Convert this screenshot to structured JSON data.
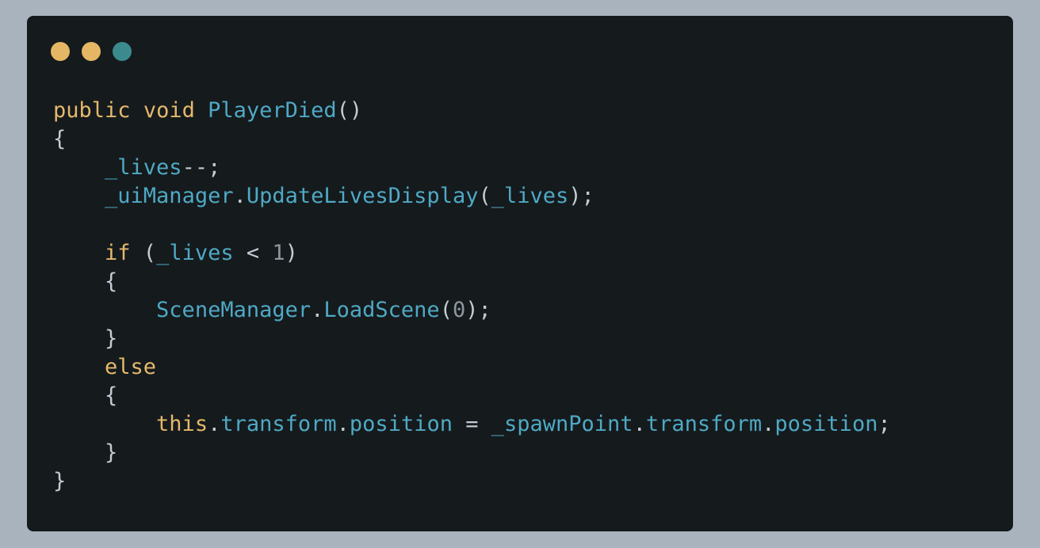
{
  "window": {
    "dots": [
      {
        "name": "dot-1",
        "color": "#e5b764"
      },
      {
        "name": "dot-2",
        "color": "#e5b764"
      },
      {
        "name": "dot-3",
        "color": "#3b8a8e"
      }
    ]
  },
  "code": {
    "lines": [
      [
        {
          "t": "public",
          "c": "kw"
        },
        {
          "t": " ",
          "c": "pn"
        },
        {
          "t": "void",
          "c": "kw"
        },
        {
          "t": " ",
          "c": "pn"
        },
        {
          "t": "PlayerDied",
          "c": "fn"
        },
        {
          "t": "()",
          "c": "pn"
        }
      ],
      [
        {
          "t": "{",
          "c": "pn"
        }
      ],
      [
        {
          "t": "    ",
          "c": "pn"
        },
        {
          "t": "_lives",
          "c": "id"
        },
        {
          "t": "--;",
          "c": "pn"
        }
      ],
      [
        {
          "t": "    ",
          "c": "pn"
        },
        {
          "t": "_uiManager",
          "c": "id"
        },
        {
          "t": ".",
          "c": "pn"
        },
        {
          "t": "UpdateLivesDisplay",
          "c": "fn"
        },
        {
          "t": "(",
          "c": "pn"
        },
        {
          "t": "_lives",
          "c": "id"
        },
        {
          "t": ");",
          "c": "pn"
        }
      ],
      [],
      [
        {
          "t": "    ",
          "c": "pn"
        },
        {
          "t": "if",
          "c": "kw"
        },
        {
          "t": " (",
          "c": "pn"
        },
        {
          "t": "_lives",
          "c": "id"
        },
        {
          "t": " < ",
          "c": "op"
        },
        {
          "t": "1",
          "c": "num"
        },
        {
          "t": ")",
          "c": "pn"
        }
      ],
      [
        {
          "t": "    {",
          "c": "pn"
        }
      ],
      [
        {
          "t": "        ",
          "c": "pn"
        },
        {
          "t": "SceneManager",
          "c": "id"
        },
        {
          "t": ".",
          "c": "pn"
        },
        {
          "t": "LoadScene",
          "c": "fn"
        },
        {
          "t": "(",
          "c": "pn"
        },
        {
          "t": "0",
          "c": "num"
        },
        {
          "t": ");",
          "c": "pn"
        }
      ],
      [
        {
          "t": "    }",
          "c": "pn"
        }
      ],
      [
        {
          "t": "    ",
          "c": "pn"
        },
        {
          "t": "else",
          "c": "kw"
        }
      ],
      [
        {
          "t": "    {",
          "c": "pn"
        }
      ],
      [
        {
          "t": "        ",
          "c": "pn"
        },
        {
          "t": "this",
          "c": "kw"
        },
        {
          "t": ".",
          "c": "pn"
        },
        {
          "t": "transform",
          "c": "id"
        },
        {
          "t": ".",
          "c": "pn"
        },
        {
          "t": "position",
          "c": "id"
        },
        {
          "t": " = ",
          "c": "op"
        },
        {
          "t": "_spawnPoint",
          "c": "id"
        },
        {
          "t": ".",
          "c": "pn"
        },
        {
          "t": "transform",
          "c": "id"
        },
        {
          "t": ".",
          "c": "pn"
        },
        {
          "t": "position",
          "c": "id"
        },
        {
          "t": ";",
          "c": "pn"
        }
      ],
      [
        {
          "t": "    }",
          "c": "pn"
        }
      ],
      [
        {
          "t": "}",
          "c": "pn"
        }
      ]
    ]
  }
}
